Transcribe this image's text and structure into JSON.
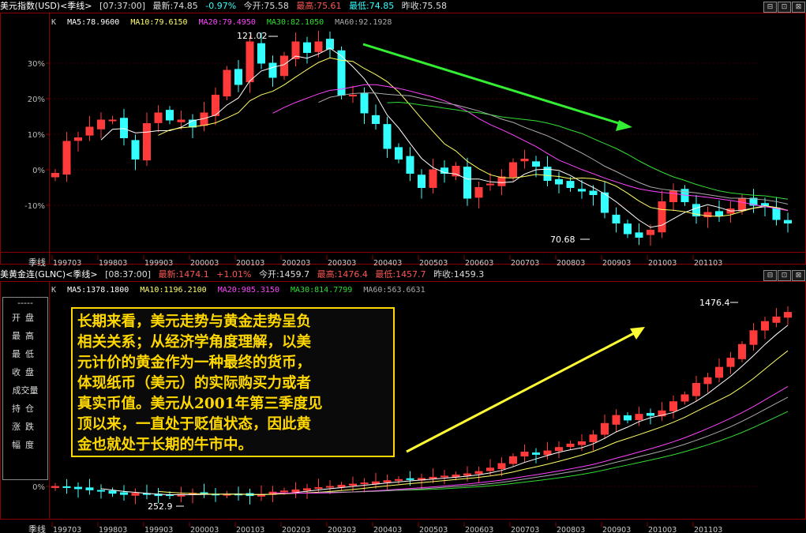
{
  "top_header": {
    "title": "美元指数(USD)<季线>",
    "time": "[07:37:00]",
    "latest": "最新:74.85",
    "change": "-0.97%",
    "open": "今开:75.58",
    "high": "最高:75.61",
    "low": "最低:74.85",
    "prev_close": "昨收:75.58"
  },
  "top_ma": {
    "k": "K",
    "ma5": "MA5:78.9600",
    "ma10": "MA10:79.6150",
    "ma20": "MA20:79.4950",
    "ma30": "MA30:82.1050",
    "ma60": "MA60:92.1928"
  },
  "bottom_header": {
    "title": "美黄金连(GLNC)<季线>",
    "time": "[08:37:00]",
    "latest": "最新:1474.1",
    "change": "+1.01%",
    "open": "今开:1459.7",
    "high": "最高:1476.4",
    "low": "最低:1457.7",
    "prev_close": "昨收:1459.3"
  },
  "bottom_ma": {
    "k": "K",
    "ma5": "MA5:1378.1800",
    "ma10": "MA10:1196.2100",
    "ma20": "MA20:985.3150",
    "ma30": "MA30:814.7799",
    "ma60": "MA60:563.6631"
  },
  "side_panel": {
    "dash": "-----",
    "items": [
      "开盘",
      "最高",
      "最低",
      "收盘",
      "成交量",
      "持仓",
      "涨跌",
      "幅度"
    ]
  },
  "annotation_lines": [
    "长期来看，美元走势与黄金走势呈负",
    "相关关系；从经济学角度理解，以美",
    "元计价的黄金作为一种最终的货币，",
    "体现纸币（美元）的实际购买力或者",
    "真实币值。美元从2001年第三季度见",
    "顶以来，一直处于贬值状态，因此黄",
    "金也就处于长期的牛市中。"
  ],
  "window_buttons": [
    "⊟",
    "⊡",
    "⊠"
  ],
  "colors": {
    "up": "#ff3a3a",
    "down": "#33ffff",
    "ma5": "#ffffff",
    "ma10": "#ffff66",
    "ma20": "#ff44ff",
    "ma30": "#33dd33",
    "ma60": "#aaaaaa",
    "arrow_usd": "#33ee33",
    "arrow_gold": "#ffff33",
    "text_box": "#ffd800"
  },
  "chart_data": [
    {
      "type": "candlestick",
      "title": "美元指数(USD)<季线>",
      "axis_period_label": "季线",
      "x_ticks": [
        "199703",
        "199803",
        "199903",
        "200003",
        "200103",
        "200203",
        "200303",
        "200403",
        "200503",
        "200603",
        "200703",
        "200803",
        "200903",
        "201003",
        "201103"
      ],
      "y_ticks": [
        "30%",
        "20%",
        "10%",
        "0%",
        "-10%"
      ],
      "ylim_pct": [
        -21,
        38
      ],
      "annotations": [
        "121.02",
        "70.68"
      ],
      "close_pct": [
        -1,
        8,
        9,
        12,
        14,
        14,
        9,
        3,
        13,
        16,
        14,
        14,
        12,
        16,
        21,
        28,
        24,
        36,
        30,
        26,
        32,
        36,
        33,
        36,
        34,
        21,
        21,
        16,
        13,
        6,
        3,
        -1,
        -5,
        0,
        -1,
        1,
        -8,
        -5,
        -4,
        -2,
        2,
        3,
        1,
        -3,
        -4,
        -5,
        -6,
        -7,
        -12,
        -15,
        -18,
        -19,
        -17,
        -9,
        -6,
        -9,
        -13,
        -12,
        -13,
        -11,
        -8,
        -10,
        -10,
        -14,
        -15
      ]
    },
    {
      "type": "candlestick",
      "title": "美黄金连(GLNC)<季线>",
      "axis_period_label": "季线",
      "x_ticks": [
        "199703",
        "199803",
        "199903",
        "200003",
        "200103",
        "200203",
        "200303",
        "200403",
        "200503",
        "200603",
        "200703",
        "200803",
        "200903",
        "201003",
        "201103"
      ],
      "y_ticks": [
        "0%"
      ],
      "annotations": [
        "1476.4",
        "252.9"
      ],
      "close_pct": [
        0,
        -1,
        -2,
        -3,
        -4,
        -6,
        -7,
        -6,
        -7,
        -8,
        -8,
        -7,
        -6,
        -6,
        -7,
        -7,
        -7,
        -8,
        -7,
        -5,
        -4,
        -3,
        -2,
        -1,
        0,
        1,
        2,
        3,
        4,
        5,
        6,
        6,
        7,
        8,
        9,
        10,
        11,
        13,
        16,
        20,
        26,
        30,
        28,
        31,
        34,
        37,
        39,
        45,
        55,
        62,
        58,
        63,
        62,
        66,
        74,
        80,
        90,
        95,
        104,
        112,
        124,
        136,
        144,
        148,
        152
      ]
    }
  ]
}
